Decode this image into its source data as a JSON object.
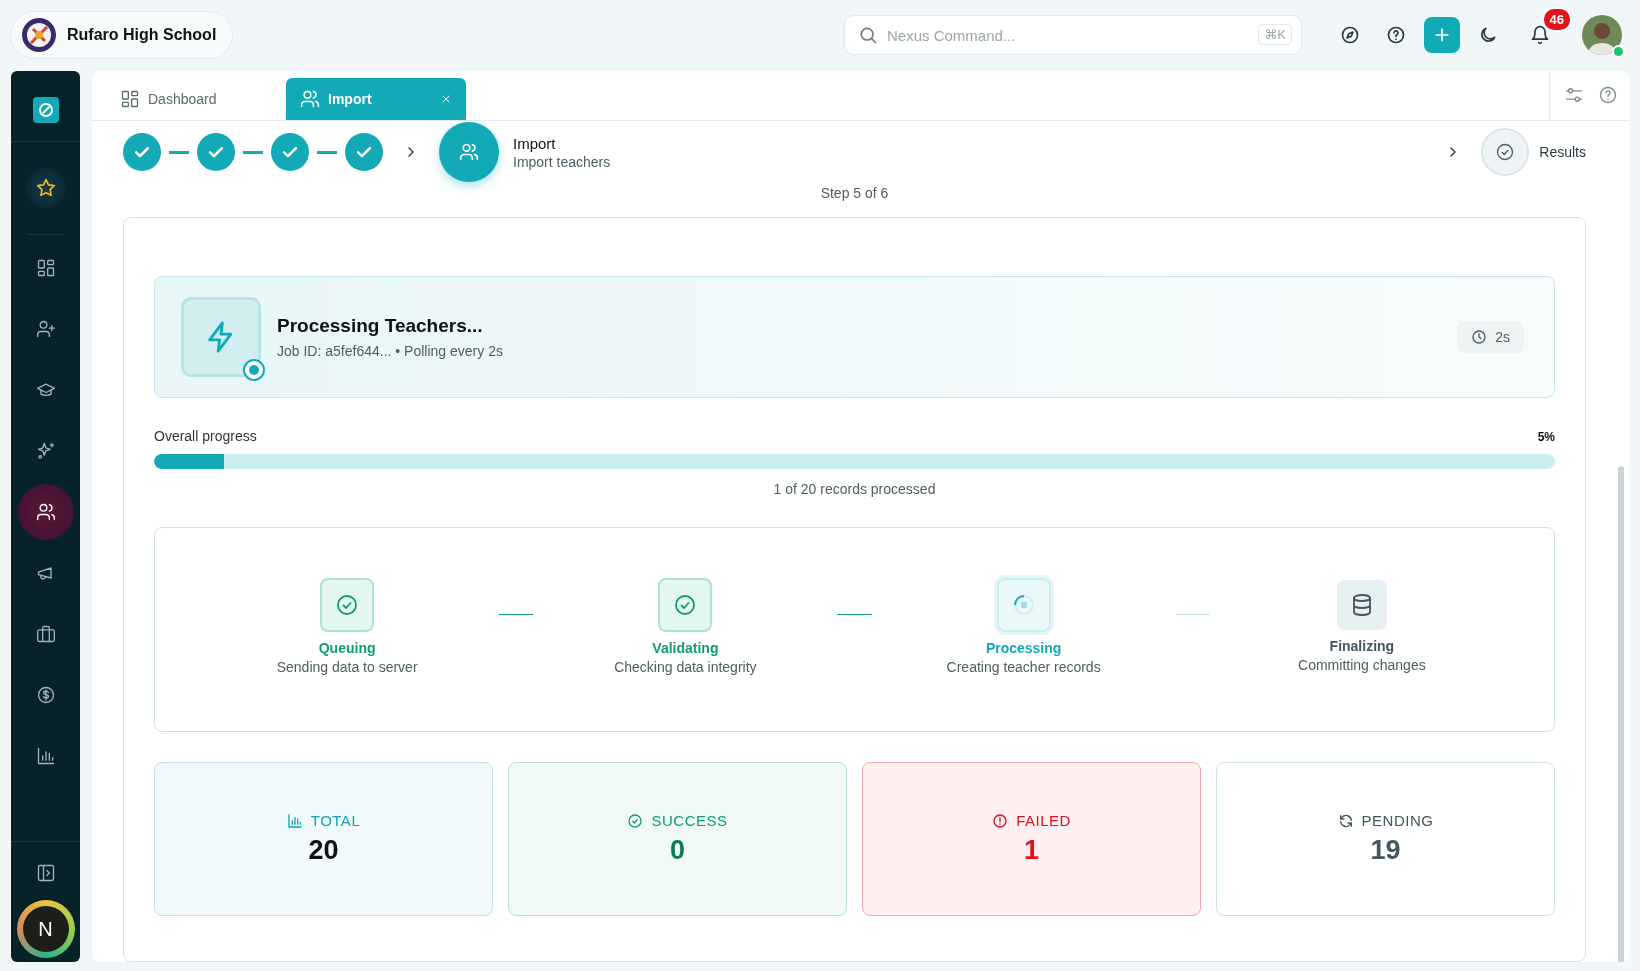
{
  "header": {
    "school_name": "Rufaro High School",
    "search_placeholder": "Nexus Command...",
    "search_shortcut": "⌘K",
    "notification_count": "46",
    "user_online": true
  },
  "sidebar": {
    "items": [
      {
        "selected": false
      },
      {
        "selected": false
      },
      {
        "selected": false
      },
      {
        "selected": false
      },
      {
        "selected": true
      },
      {
        "selected": false
      },
      {
        "selected": false
      },
      {
        "selected": false
      },
      {
        "selected": false
      }
    ],
    "user_initial": "N"
  },
  "tabs": [
    {
      "label": "Dashboard",
      "selected": false,
      "closable": false
    },
    {
      "label": "Import",
      "selected": true,
      "closable": true
    }
  ],
  "stepper": {
    "steps": [
      {
        "completed": true,
        "current": false
      },
      {
        "completed": true,
        "current": false
      },
      {
        "completed": true,
        "current": false
      },
      {
        "completed": true,
        "current": false
      },
      {
        "completed": false,
        "current": true,
        "title": "Import",
        "subtitle": "Import teachers"
      },
      {
        "completed": false,
        "current": false,
        "title": "Results"
      }
    ],
    "step_label": "Step 5 of 6"
  },
  "job": {
    "title": "Processing Teachers...",
    "details": "Job ID: a5fef644... • Polling every 2s",
    "elapsed": "2s"
  },
  "progress": {
    "label": "Overall progress",
    "percent": "5%",
    "level": 0.05,
    "caption": "1 of 20 records processed"
  },
  "phases": [
    {
      "name": "Queuing",
      "description": "Sending data to server",
      "completed": true,
      "active": false
    },
    {
      "name": "Validating",
      "description": "Checking data integrity",
      "completed": true,
      "active": false
    },
    {
      "name": "Processing",
      "description": "Creating teacher records",
      "completed": false,
      "active": true
    },
    {
      "name": "Finalizing",
      "description": "Committing changes",
      "completed": false,
      "active": false
    }
  ],
  "stats": [
    {
      "kind": "total",
      "label": "TOTAL",
      "value": "20"
    },
    {
      "kind": "success",
      "label": "SUCCESS",
      "value": "0"
    },
    {
      "kind": "failed",
      "label": "FAILED",
      "value": "1"
    },
    {
      "kind": "pending",
      "label": "PENDING",
      "value": "19"
    }
  ]
}
